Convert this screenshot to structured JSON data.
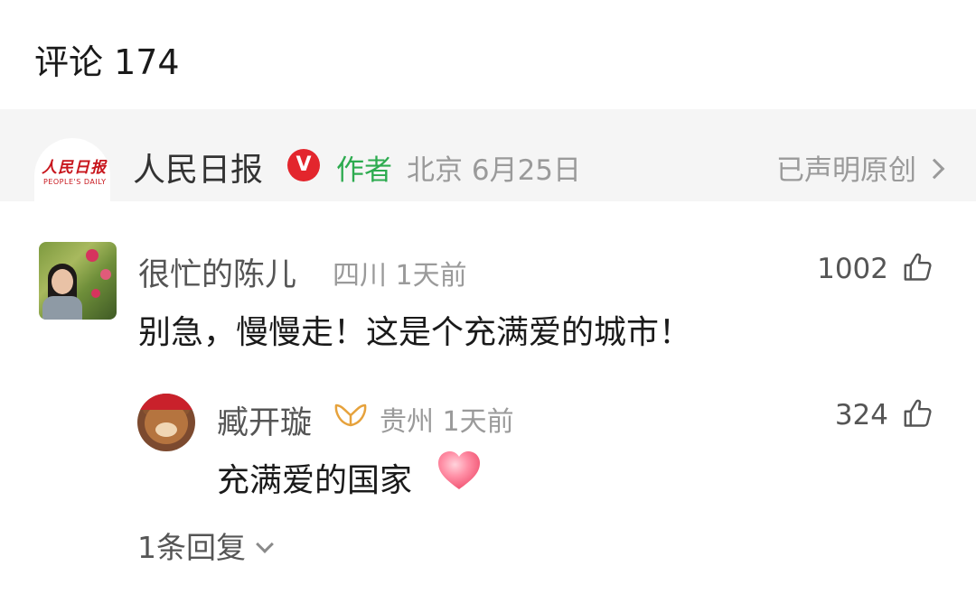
{
  "header": {
    "title": "评论 174"
  },
  "author": {
    "logo_text": "人民日报",
    "logo_subtext": "PEOPLE'S DAILY",
    "name": "人民日报",
    "verified_glyph": "V",
    "tag": "作者",
    "location_date": "北京 6月25日",
    "original_label": "已声明原创"
  },
  "comment": {
    "user": "很忙的陈儿",
    "meta": "四川 1天前",
    "likes": "1002",
    "text": "别急，慢慢走！这是个充满爱的城市！"
  },
  "reply": {
    "user": "臧开璇",
    "meta": "贵州 1天前",
    "likes": "324",
    "text": "充满爱的国家"
  },
  "replies_link": {
    "label": "1条回复"
  },
  "colors": {
    "author_tag": "#2dab4f",
    "verified_badge": "#e3262d",
    "logo": "#c8161d",
    "muted_text": "#9a9a9a",
    "author_bar_bg": "#f5f5f5"
  },
  "icons": {
    "verified": "verified-badge-icon",
    "like": "thumbs-up-icon",
    "chevron_right": "chevron-right-icon",
    "chevron_down": "chevron-down-icon",
    "member_badge": "member-badge-icon",
    "heart": "heart-emoji-icon"
  }
}
